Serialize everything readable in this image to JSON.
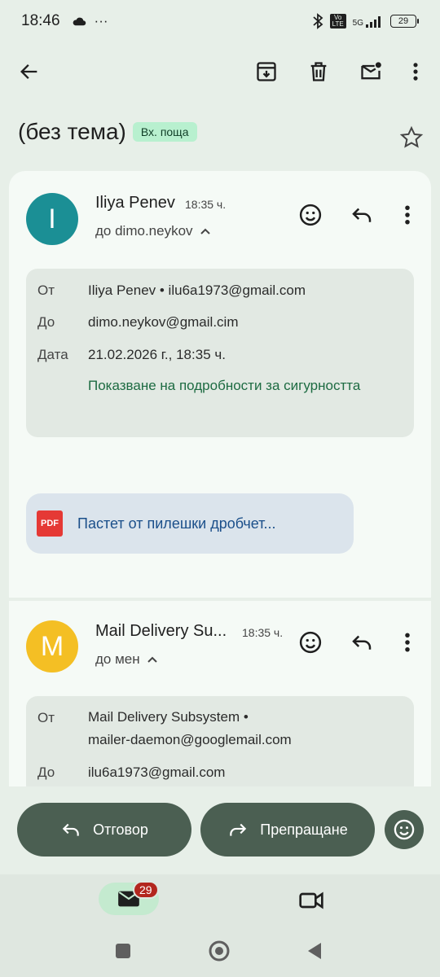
{
  "status_bar": {
    "time": "18:46",
    "more": "···",
    "network": "5G",
    "volte": "Vo LTE",
    "battery": "29"
  },
  "subject": {
    "title": "(без тема)",
    "label": "Вх. поща"
  },
  "message1": {
    "avatar_letter": "I",
    "avatar_color": "#1b8f95",
    "sender": "Iliya Penev",
    "time": "18:35 ч.",
    "recipient": "до dimo.neykov",
    "details": {
      "from_label": "От",
      "from_value": "Iliya Penev • ilu6a1973@gmail.com",
      "to_label": "До",
      "to_value": "dimo.neykov@gmail.cim",
      "date_label": "Дата",
      "date_value": "21.02.2026 г., 18:35 ч.",
      "security_link": "Показване на подробности за сигурността"
    },
    "attachment": {
      "type_label": "PDF",
      "name": "Пастет от пилешки дробчет..."
    }
  },
  "message2": {
    "avatar_letter": "M",
    "avatar_color": "#f4bf24",
    "sender": "Mail Delivery Su...",
    "time": "18:35 ч.",
    "recipient": "до мен",
    "details": {
      "from_label": "От",
      "from_value_line1": "Mail Delivery Subsystem •",
      "from_value_line2": "mailer-daemon@googlemail.com",
      "to_label": "До",
      "to_value": "ilu6a1973@gmail.com"
    }
  },
  "actions": {
    "reply_label": "Отговор",
    "forward_label": "Препращане"
  },
  "nav": {
    "mail_badge": "29"
  }
}
